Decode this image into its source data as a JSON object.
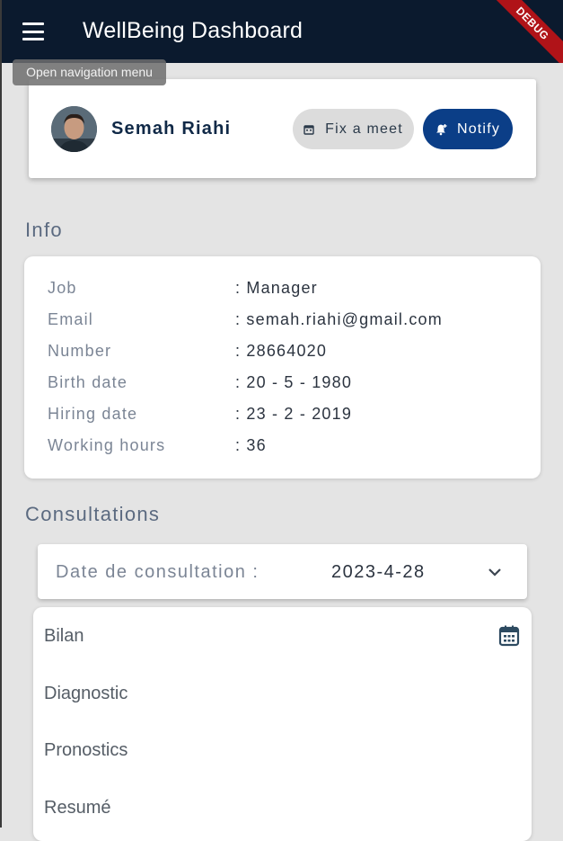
{
  "appbar": {
    "title": "WellBeing Dashboard",
    "debug_label": "DEBUG",
    "menu_icon": "menu-icon",
    "tooltip": "Open navigation menu",
    "background": "#0b1a2e"
  },
  "profile": {
    "name": "Semah Riahi",
    "meet_button": "Fix a meet",
    "meet_icon": "calendar-icon",
    "notify_button": "Notify",
    "notify_icon": "bell-plus-icon",
    "accent": "#0b3e87"
  },
  "info": {
    "title": "Info",
    "rows": [
      {
        "label": "Job",
        "value": ": Manager"
      },
      {
        "label": "Email",
        "value": ": semah.riahi@gmail.com"
      },
      {
        "label": "Number",
        "value": ": 28664020"
      },
      {
        "label": "Birth date",
        "value": ": 20 - 5 - 1980"
      },
      {
        "label": "Hiring date",
        "value": ": 23 - 2 - 2019"
      },
      {
        "label": "Working hours",
        "value": ": 36"
      }
    ]
  },
  "consultations": {
    "title": "Consultations",
    "date_label": "Date de consultation :",
    "date_value": "2023-4-28",
    "dropdown_icon": "chevron-down-icon",
    "fields": [
      {
        "label": "Bilan"
      },
      {
        "label": "Diagnostic"
      },
      {
        "label": "Pronostics"
      },
      {
        "label": "Resumé"
      }
    ],
    "calendar_icon": "calendar-icon"
  }
}
